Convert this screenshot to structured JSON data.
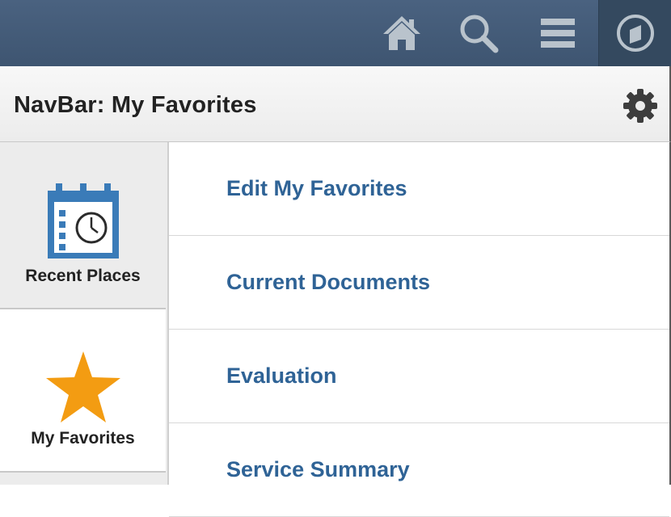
{
  "topbar": {
    "icons": [
      "home-icon",
      "search-icon",
      "menu-icon",
      "navbar-compass-icon"
    ],
    "background": "#44596f"
  },
  "header": {
    "title": "NavBar: My Favorites",
    "settings_icon": "gear-icon"
  },
  "sidebar": {
    "tabs": [
      {
        "label": "Recent Places",
        "icon": "calendar-clock-icon"
      },
      {
        "label": "My Favorites",
        "icon": "star-icon",
        "selected": true
      }
    ]
  },
  "favorites": {
    "items": [
      {
        "label": "Edit My Favorites"
      },
      {
        "label": "Current Documents"
      },
      {
        "label": "Evaluation"
      },
      {
        "label": "Service Summary"
      }
    ],
    "link_color": "#2f6396"
  }
}
